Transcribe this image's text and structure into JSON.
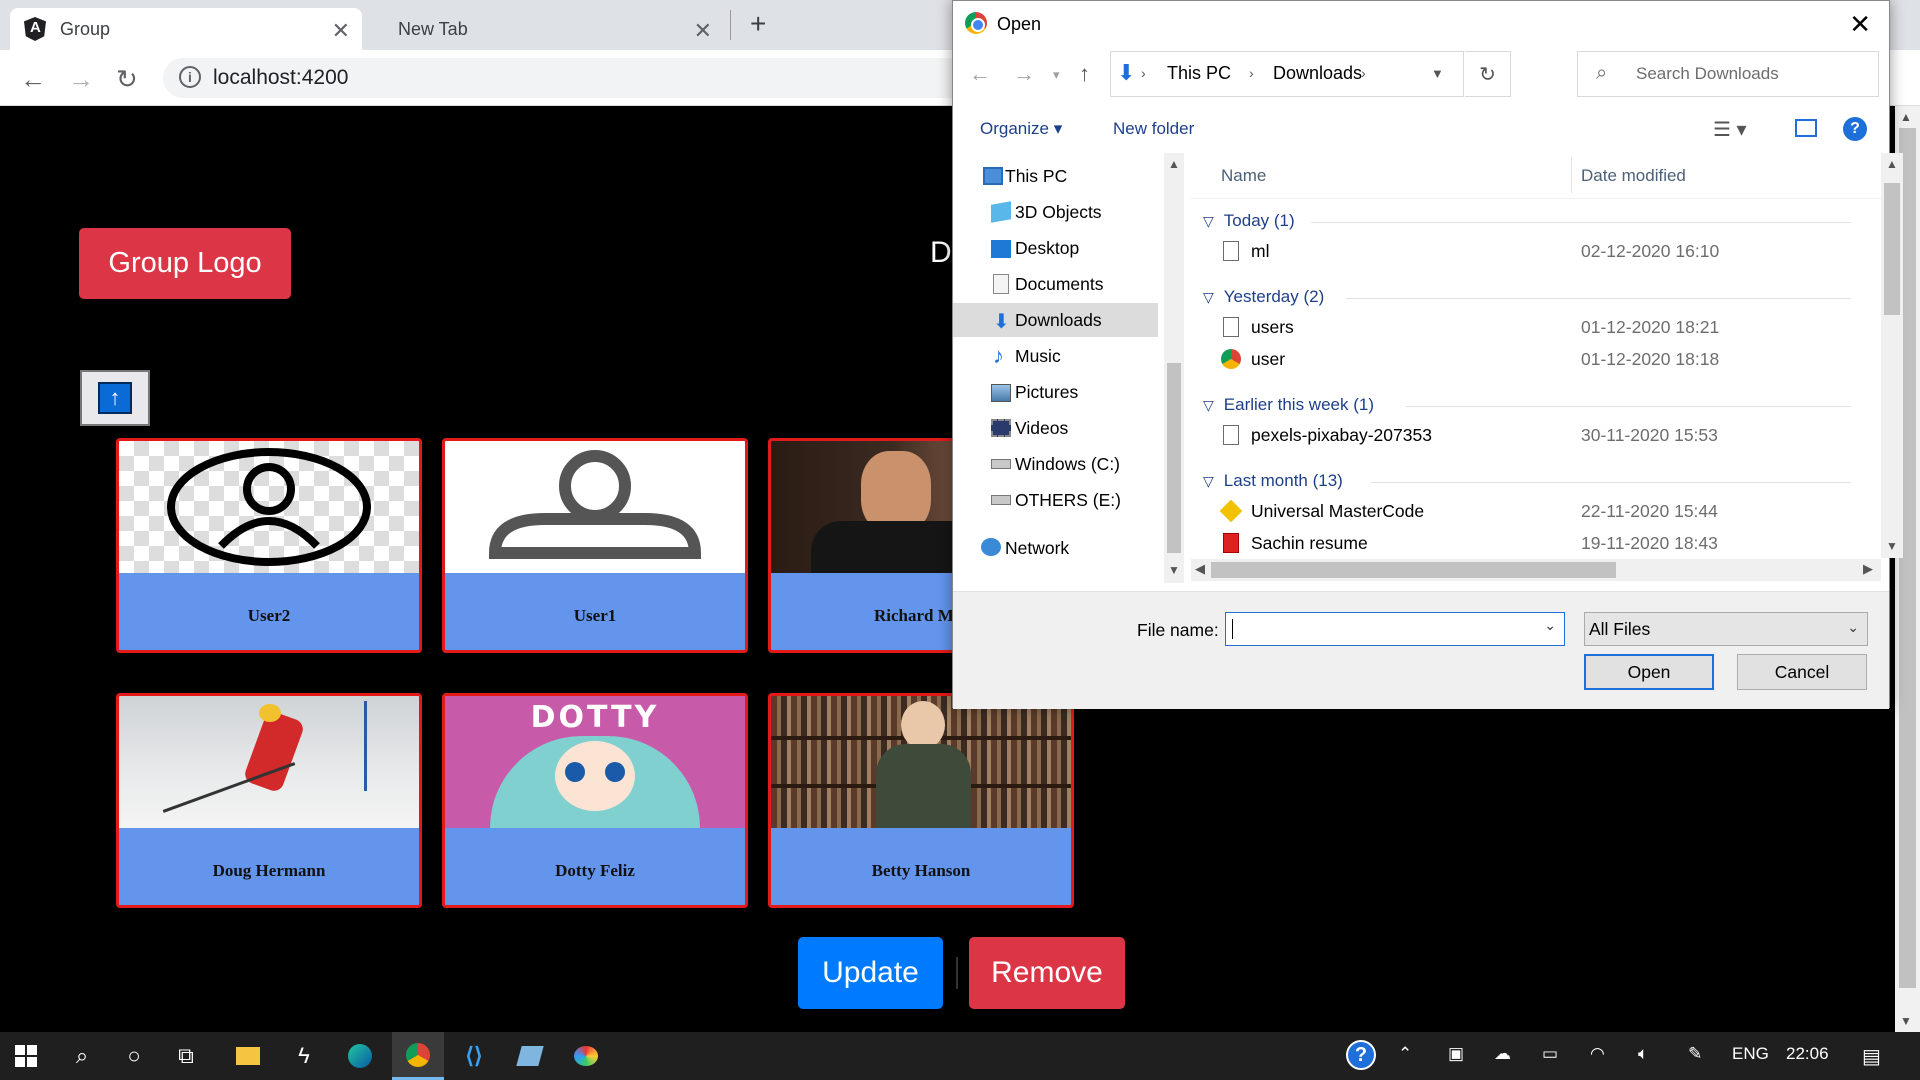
{
  "browser": {
    "tabs": [
      {
        "title": "Group",
        "active": true
      },
      {
        "title": "New Tab",
        "active": false
      }
    ],
    "url": "localhost:4200"
  },
  "page": {
    "group_logo_label": "Group Logo",
    "heading_fragment": "D",
    "upload_icon": "upload-arrow-icon",
    "members": [
      {
        "name": "User2",
        "photo": "checkered-avatar-placeholder"
      },
      {
        "name": "User1",
        "photo": "gray-avatar-placeholder"
      },
      {
        "name": "Richard Mat",
        "photo": "man-in-suit-photo"
      },
      {
        "name": "Doug Hermann",
        "photo": "skier-photo"
      },
      {
        "name": "Dotty Feliz",
        "photo": "dotty-doll-photo",
        "photo_text": "DOTTY"
      },
      {
        "name": "Betty Hanson",
        "photo": "woman-bookshelf-photo"
      }
    ],
    "update_label": "Update",
    "remove_label": "Remove"
  },
  "dialog": {
    "title": "Open",
    "breadcrumb": [
      "This PC",
      "Downloads"
    ],
    "search_placeholder": "Search Downloads",
    "organize_label": "Organize",
    "new_folder_label": "New folder",
    "nav_items": [
      {
        "label": "This PC",
        "icon": "computer-icon"
      },
      {
        "label": "3D Objects",
        "icon": "3d-objects-icon"
      },
      {
        "label": "Desktop",
        "icon": "desktop-icon"
      },
      {
        "label": "Documents",
        "icon": "documents-icon"
      },
      {
        "label": "Downloads",
        "icon": "downloads-icon",
        "selected": true
      },
      {
        "label": "Music",
        "icon": "music-icon"
      },
      {
        "label": "Pictures",
        "icon": "pictures-icon"
      },
      {
        "label": "Videos",
        "icon": "videos-icon"
      },
      {
        "label": "Windows (C:)",
        "icon": "drive-icon"
      },
      {
        "label": "OTHERS (E:)",
        "icon": "drive-icon"
      },
      {
        "label": "Network",
        "icon": "network-icon"
      }
    ],
    "columns": {
      "name": "Name",
      "date": "Date modified"
    },
    "groups": [
      {
        "label": "Today (1)",
        "files": [
          {
            "name": "ml",
            "date": "02-12-2020 16:10",
            "icon": "file-icon"
          }
        ]
      },
      {
        "label": "Yesterday (2)",
        "files": [
          {
            "name": "users",
            "date": "01-12-2020 18:21",
            "icon": "file-icon"
          },
          {
            "name": "user",
            "date": "01-12-2020 18:18",
            "icon": "chrome-file-icon"
          }
        ]
      },
      {
        "label": "Earlier this week (1)",
        "files": [
          {
            "name": "pexels-pixabay-207353",
            "date": "30-11-2020 15:53",
            "icon": "file-icon"
          }
        ]
      },
      {
        "label": "Last month (13)",
        "files": [
          {
            "name": "Universal MasterCode",
            "date": "22-11-2020 15:44",
            "icon": "shortcut-icon"
          },
          {
            "name": "Sachin resume",
            "date": "19-11-2020 18:43",
            "icon": "pdf-icon"
          }
        ]
      }
    ],
    "file_name_label": "File name:",
    "file_name_value": "",
    "filter_value": "All Files",
    "open_label": "Open",
    "cancel_label": "Cancel"
  },
  "taskbar": {
    "tray_lang": "ENG",
    "clock": "22:06"
  }
}
